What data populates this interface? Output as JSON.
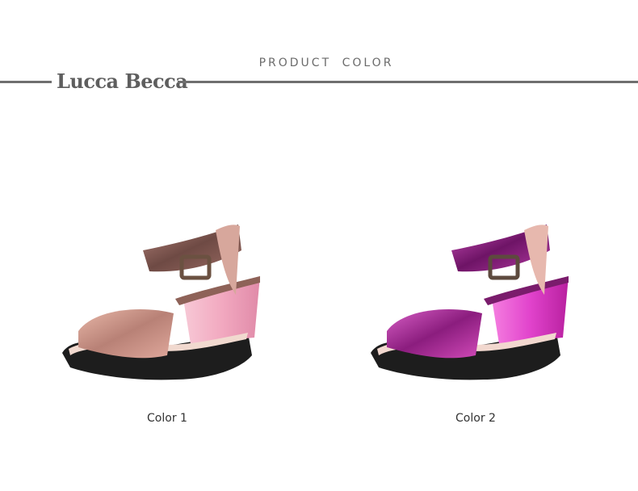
{
  "header": {
    "section_title": "PRODUCT  COLOR",
    "brand": "Lucca Becca"
  },
  "products": [
    {
      "caption": "Color 1",
      "shade": "rose-gold",
      "accent": "#c98b8a",
      "heel": "#f3b0c6",
      "strap": "#7a4b44"
    },
    {
      "caption": "Color 2",
      "shade": "metallic-magenta",
      "accent": "#b3249b",
      "heel": "#e05ad0",
      "strap": "#7a1c6c"
    }
  ]
}
